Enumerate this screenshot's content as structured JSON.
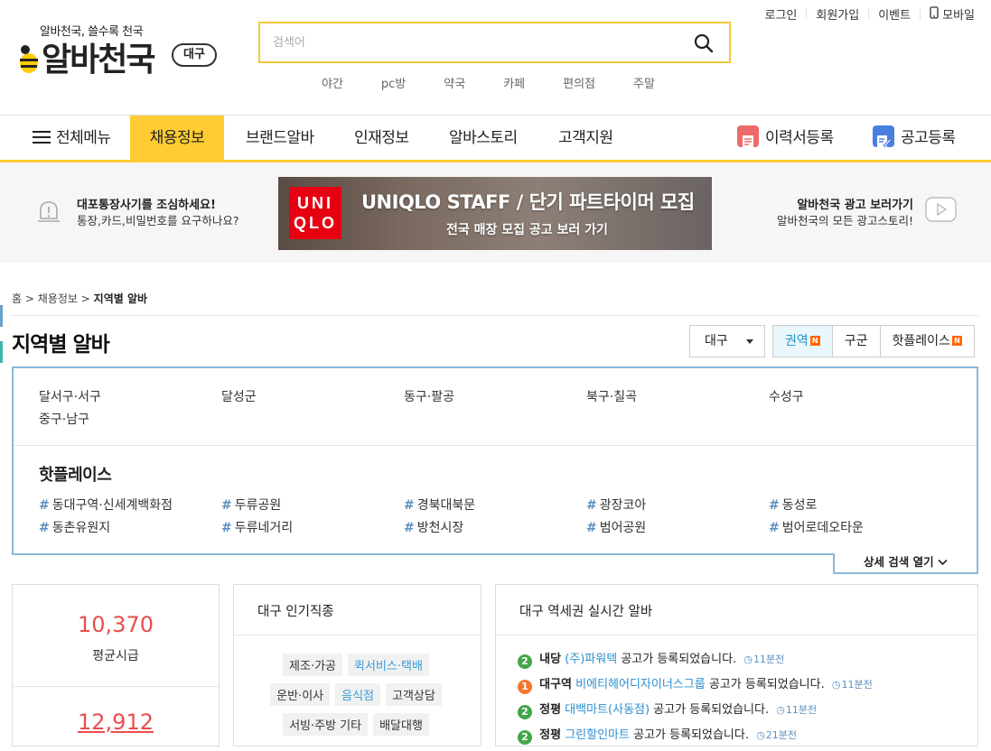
{
  "header": {
    "tagline": "알바천국, 쓸수록 천국",
    "logo_text": "알바천국",
    "region": "대구",
    "search": {
      "placeholder": "검색어"
    },
    "keywords": [
      "야간",
      "pc방",
      "약국",
      "카페",
      "편의점",
      "주말"
    ],
    "util": {
      "login": "로그인",
      "signup": "회원가입",
      "event": "이벤트",
      "mobile": "모바일"
    }
  },
  "gnb": {
    "all_menu": "전체메뉴",
    "items": [
      "채용정보",
      "브랜드알바",
      "인재정보",
      "알바스토리",
      "고객지원"
    ],
    "resume": "이력서등록",
    "post": "공고등록",
    "colors": {
      "accent": "#ffcc33",
      "resume_icon": "#ef6a6a",
      "post_icon": "#4a7fe0"
    }
  },
  "banner": {
    "warn_title": "대포통장사기를 조심하세요!",
    "warn_text": "통장,카드,비밀번호를 요구하나요?",
    "ad_logo_line1": "UNI",
    "ad_logo_line2": "QLO",
    "ad_title": "UNIQLO STAFF / 단기 파트타이머 모집",
    "ad_sub": "전국 매장 모집 공고 보러 가기",
    "adv_title": "알바천국 광고 보러가기",
    "adv_text": "알바천국의 모든 광고스토리!"
  },
  "breadcrumb": {
    "home": "홈",
    "sep": ">",
    "jobs": "채용정보",
    "current": "지역별 알바"
  },
  "page_title": "지역별 알바",
  "region_select": "대구",
  "tabs": [
    {
      "label": "권역",
      "badge": "N"
    },
    {
      "label": "구군",
      "badge": ""
    },
    {
      "label": "핫플레이스",
      "badge": "N"
    }
  ],
  "regions": [
    "달서구·서구",
    "달성군",
    "동구·팔공",
    "북구·칠곡",
    "수성구",
    "중구·남구"
  ],
  "hotplace": {
    "title": "핫플레이스",
    "items": [
      "동대구역·신세계백화점",
      "두류공원",
      "경북대북문",
      "광장코아",
      "동성로",
      "동촌유원지",
      "두류네거리",
      "방천시장",
      "범어공원",
      "범어로데오타운"
    ]
  },
  "detail_search": "상세 검색 열기",
  "wage": {
    "avg_value": "10,370",
    "avg_label": "평균시급",
    "second_value": "12,912"
  },
  "popular_jobs": {
    "title": "대구 인기직종",
    "tags": [
      {
        "label": "제조·가공",
        "highlight": false
      },
      {
        "label": "퀵서비스·택배",
        "highlight": true
      },
      {
        "label": "운반·이사",
        "highlight": false
      },
      {
        "label": "음식점",
        "highlight": true
      },
      {
        "label": "고객상담",
        "highlight": false
      },
      {
        "label": "서빙·주방 기타",
        "highlight": false
      },
      {
        "label": "배달대행",
        "highlight": false
      }
    ]
  },
  "realtime": {
    "title": "대구 역세권 실시간 알바",
    "items": [
      {
        "num": "2",
        "color": "#43a649",
        "station": "내당",
        "company": "(주)파워텍",
        "text": "공고가 등록되었습니다.",
        "time": "11분전"
      },
      {
        "num": "1",
        "color": "#f4772b",
        "station": "대구역",
        "company": "비에티헤어디자이너스그룹",
        "text": "공고가 등록되었습니다.",
        "time": "11분전"
      },
      {
        "num": "2",
        "color": "#43a649",
        "station": "정평",
        "company": "대백마트(사동점)",
        "text": "공고가 등록되었습니다.",
        "time": "11분전"
      },
      {
        "num": "2",
        "color": "#43a649",
        "station": "정평",
        "company": "그린할인마트",
        "text": "공고가 등록되었습니다.",
        "time": "21분전"
      }
    ]
  }
}
